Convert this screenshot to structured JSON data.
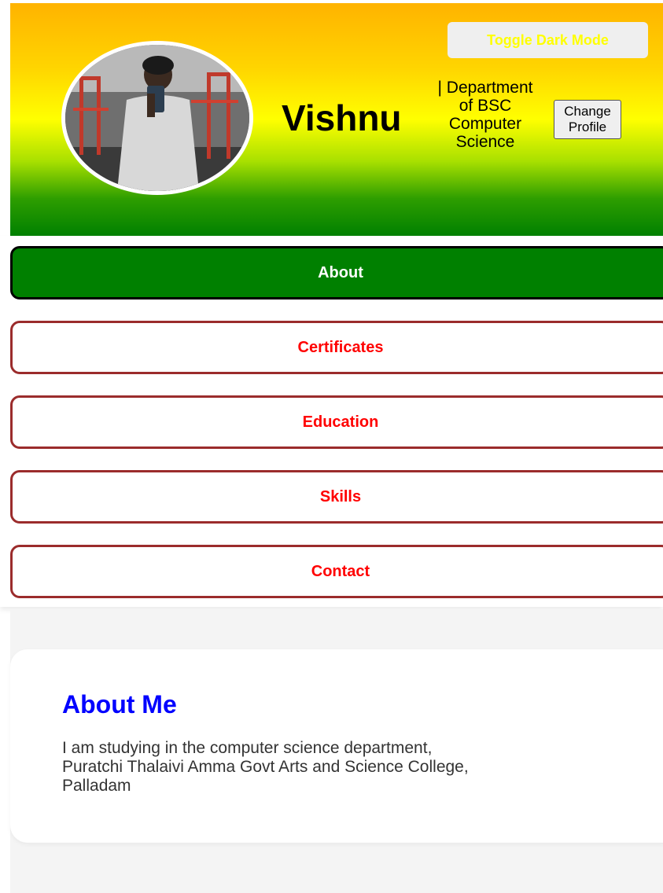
{
  "header": {
    "toggle_label": "Toggle Dark Mode",
    "name": "Vishnu",
    "department_lines": [
      "| Department",
      "of BSC",
      "Computer",
      "Science"
    ],
    "change_profile_lines": [
      "Change",
      "Profile"
    ],
    "gradient_colors": [
      "#ffb300",
      "#ffff00",
      "#008000"
    ],
    "toggle_text_color": "#ffff00"
  },
  "nav": {
    "items": [
      {
        "label": "About",
        "active": true
      },
      {
        "label": "Certificates",
        "active": false
      },
      {
        "label": "Education",
        "active": false
      },
      {
        "label": "Skills",
        "active": false
      },
      {
        "label": "Contact",
        "active": false
      }
    ],
    "active_bg": "#008000",
    "inactive_text_color": "#ff0000",
    "inactive_border_color": "#9b2c2c"
  },
  "about": {
    "title": "About Me",
    "text_lines": [
      "I am studying in the computer science department,",
      "Puratchi Thalaivi Amma Govt Arts and Science College,",
      "Palladam"
    ],
    "title_color": "#0000ff"
  }
}
